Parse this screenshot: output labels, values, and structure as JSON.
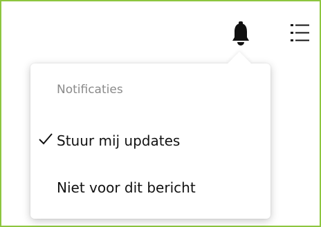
{
  "toolbar": {
    "bell_icon": "bell-icon",
    "menu_icon": "list-menu-icon"
  },
  "notification_popover": {
    "title": "Notificaties",
    "options": [
      {
        "label": "Stuur mij updates",
        "selected": true
      },
      {
        "label": "Niet voor dit bericht",
        "selected": false
      }
    ]
  },
  "colors": {
    "frame_border": "#8dc63f",
    "title_text": "#8a8a8a",
    "option_text": "#111111",
    "icon": "#111111"
  }
}
